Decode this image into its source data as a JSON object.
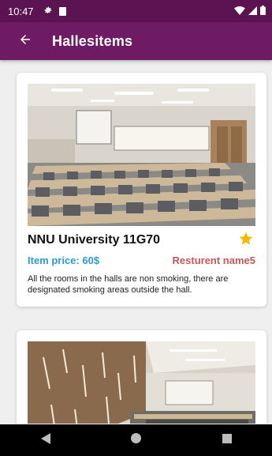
{
  "status_bar": {
    "time": "10:47"
  },
  "app_bar": {
    "title": "Hallesitems"
  },
  "items": [
    {
      "title": "NNU University 11G70",
      "price": "Item price: 60$",
      "restaurant": "Resturent name5",
      "description": "All the rooms in the halls are non smoking, there are designated smoking areas outside the hall.",
      "favorite": true
    },
    {
      "title": "",
      "price": "",
      "restaurant": "",
      "description": "",
      "favorite": false
    }
  ],
  "colors": {
    "status_bar": "#5b1351",
    "app_bar": "#6e1b63",
    "price": "#2b9ad8",
    "restaurant": "#c9565a",
    "star": "#f5b800"
  },
  "icons": {
    "back": "arrow-left-icon",
    "settings": "gear-icon",
    "sd_card": "sd-card-icon",
    "wifi": "wifi-icon",
    "signal": "signal-icon",
    "battery": "battery-icon",
    "favorite": "star-icon",
    "nav_back": "triangle-back-icon",
    "nav_home": "circle-home-icon",
    "nav_recents": "square-recents-icon"
  }
}
